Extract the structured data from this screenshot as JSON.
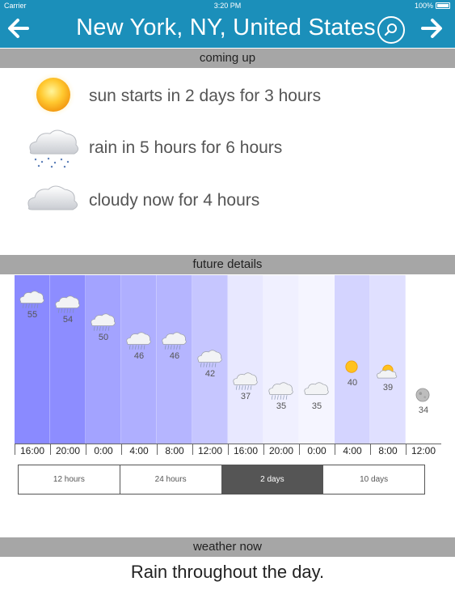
{
  "status_bar": {
    "carrier": "Carrier",
    "time": "3:20 PM",
    "battery": "100%"
  },
  "header": {
    "title": "New York, NY, United States"
  },
  "sections": {
    "coming_up": "coming up",
    "future_details": "future details",
    "weather_now": "weather now"
  },
  "coming_up": [
    {
      "icon": "sun-icon",
      "text": "sun starts in 2 days for 3 hours"
    },
    {
      "icon": "rain-cloud-icon",
      "text": "rain in 5 hours for 6 hours"
    },
    {
      "icon": "cloud-icon",
      "text": "cloudy now for 4 hours"
    }
  ],
  "forecast": {
    "times": [
      "16:00",
      "20:00",
      "0:00",
      "4:00",
      "8:00",
      "12:00",
      "16:00",
      "20:00",
      "0:00",
      "4:00",
      "8:00",
      "12:00"
    ],
    "temperatures": [
      55,
      54,
      50,
      46,
      46,
      42,
      37,
      35,
      35,
      40,
      39,
      34
    ],
    "icons": [
      "rain-cloud-icon",
      "rain-cloud-icon",
      "rain-cloud-icon",
      "rain-cloud-icon",
      "rain-cloud-icon",
      "rain-cloud-icon",
      "rain-cloud-icon",
      "rain-cloud-icon",
      "cloud-icon",
      "sun-icon",
      "partly-sunny-icon",
      "moon-icon"
    ],
    "bar_colors": [
      "#8a8aff",
      "#8d8dff",
      "#a3a3ff",
      "#afafff",
      "#b5b5ff",
      "#c6c6ff",
      "#e8e8ff",
      "#f0f0ff",
      "#f5f5ff",
      "#d4d4ff",
      "#e0e0ff",
      "#ffffff"
    ]
  },
  "range_tabs": {
    "items": [
      "12 hours",
      "24 hours",
      "2 days",
      "10 days"
    ],
    "selected": "2 days"
  },
  "weather_now": {
    "summary": "Rain throughout the day."
  }
}
